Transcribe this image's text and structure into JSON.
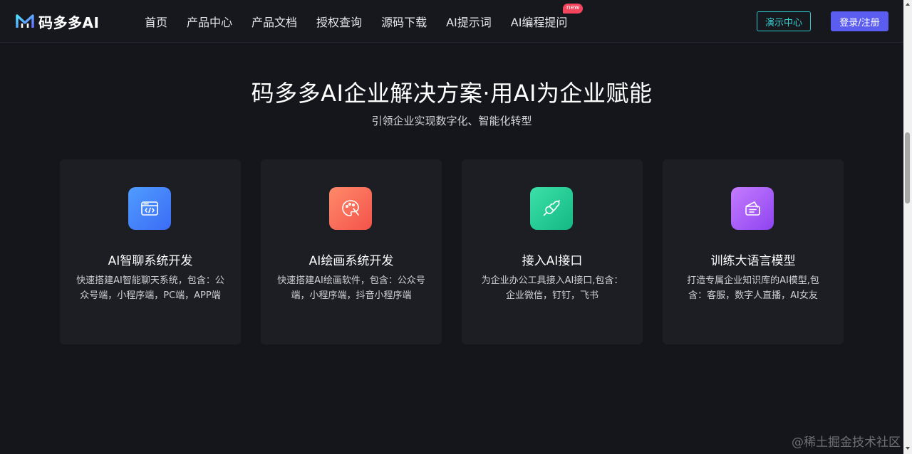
{
  "header": {
    "logo_text": "码多多AI",
    "nav": [
      {
        "label": "首页"
      },
      {
        "label": "产品中心"
      },
      {
        "label": "产品文档"
      },
      {
        "label": "授权查询"
      },
      {
        "label": "源码下载"
      },
      {
        "label": "AI提示词"
      },
      {
        "label": "AI编程提问",
        "badge": "new"
      }
    ],
    "demo_button": "演示中心",
    "login_button": "登录/注册"
  },
  "hero": {
    "title": "码多多AI企业解决方案·用AI为企业赋能",
    "subtitle": "引领企业实现数字化、智能化转型"
  },
  "cards": [
    {
      "icon": "code-window-icon",
      "gradient": [
        "#4f9cff",
        "#3b6cf5"
      ],
      "title": "AI智聊系统开发",
      "desc": "快速搭建AI智能聊天系统，包含：公众号端，小程序端，PC端，APP端"
    },
    {
      "icon": "palette-icon",
      "gradient": [
        "#ff8a6a",
        "#f4534a"
      ],
      "title": "AI绘画系统开发",
      "desc": "快速搭建AI绘画软件，包含：公众号端，小程序端，抖音小程序端"
    },
    {
      "icon": "plug-icon",
      "gradient": [
        "#3ce0a8",
        "#14b883"
      ],
      "title": "接入AI接口",
      "desc": "为企业办公工具接入AI接口,包含：企业微信，钉钉，飞书"
    },
    {
      "icon": "chat-card-icon",
      "gradient": [
        "#c57cff",
        "#8e44f0"
      ],
      "title": "训练大语言模型",
      "desc": "打造专属企业知识库的AI模型,包含：客服，数字人直播，AI女友"
    }
  ],
  "watermark": "@稀土掘金技术社区",
  "colors": {
    "background": "#15161c",
    "card": "#1c1e24",
    "accent_demo": "#38d3d3",
    "accent_login": "#5b5cf0",
    "badge": "#f5455c"
  }
}
